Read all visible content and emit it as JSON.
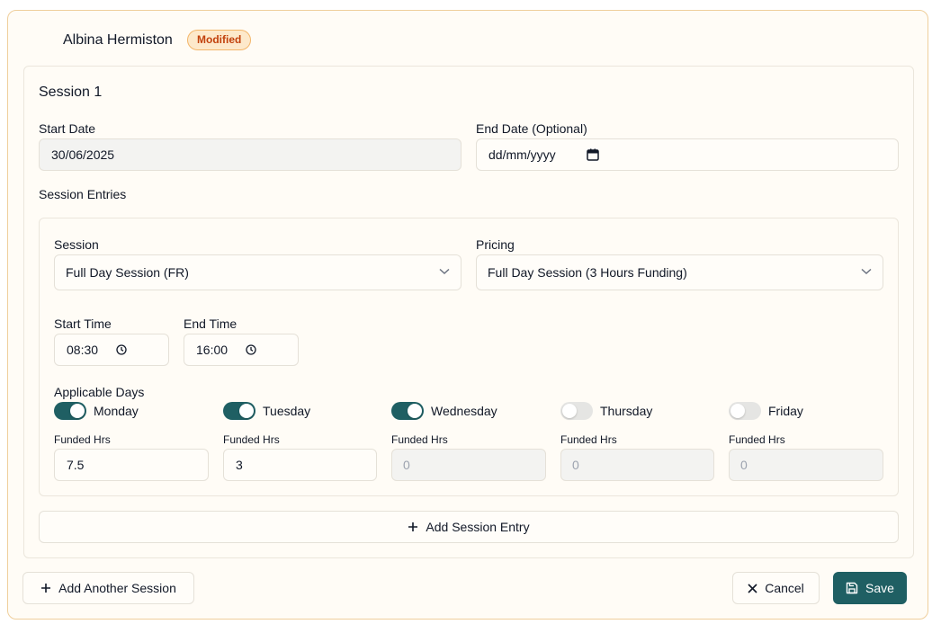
{
  "header": {
    "name": "Albina Hermiston",
    "badge": "Modified"
  },
  "session": {
    "title": "Session 1",
    "start_date_label": "Start Date",
    "start_date_value": "30/06/2025",
    "end_date_label": "End Date (Optional)",
    "end_date_value": "dd/mm/yyyy",
    "entries_label": "Session Entries"
  },
  "entry": {
    "session_label": "Session",
    "session_value": "Full Day Session (FR)",
    "pricing_label": "Pricing",
    "pricing_value": "Full Day Session (3 Hours Funding)",
    "start_time_label": "Start Time",
    "start_time_value": "08:30",
    "end_time_label": "End Time",
    "end_time_value": "16:00",
    "days_label": "Applicable Days",
    "funded_label": "Funded Hrs",
    "days": [
      {
        "name": "Monday",
        "enabled": true,
        "funded": "7.5"
      },
      {
        "name": "Tuesday",
        "enabled": true,
        "funded": "3"
      },
      {
        "name": "Wednesday",
        "enabled": true,
        "funded": "0"
      },
      {
        "name": "Thursday",
        "enabled": false,
        "funded": "0"
      },
      {
        "name": "Friday",
        "enabled": false,
        "funded": "0"
      }
    ]
  },
  "buttons": {
    "add_entry": "Add Session Entry",
    "add_session": "Add Another Session",
    "cancel": "Cancel",
    "save": "Save"
  },
  "colors": {
    "accent": "#1f5f63",
    "badge_text": "#c2410c",
    "card_border": "#efcf9c"
  }
}
